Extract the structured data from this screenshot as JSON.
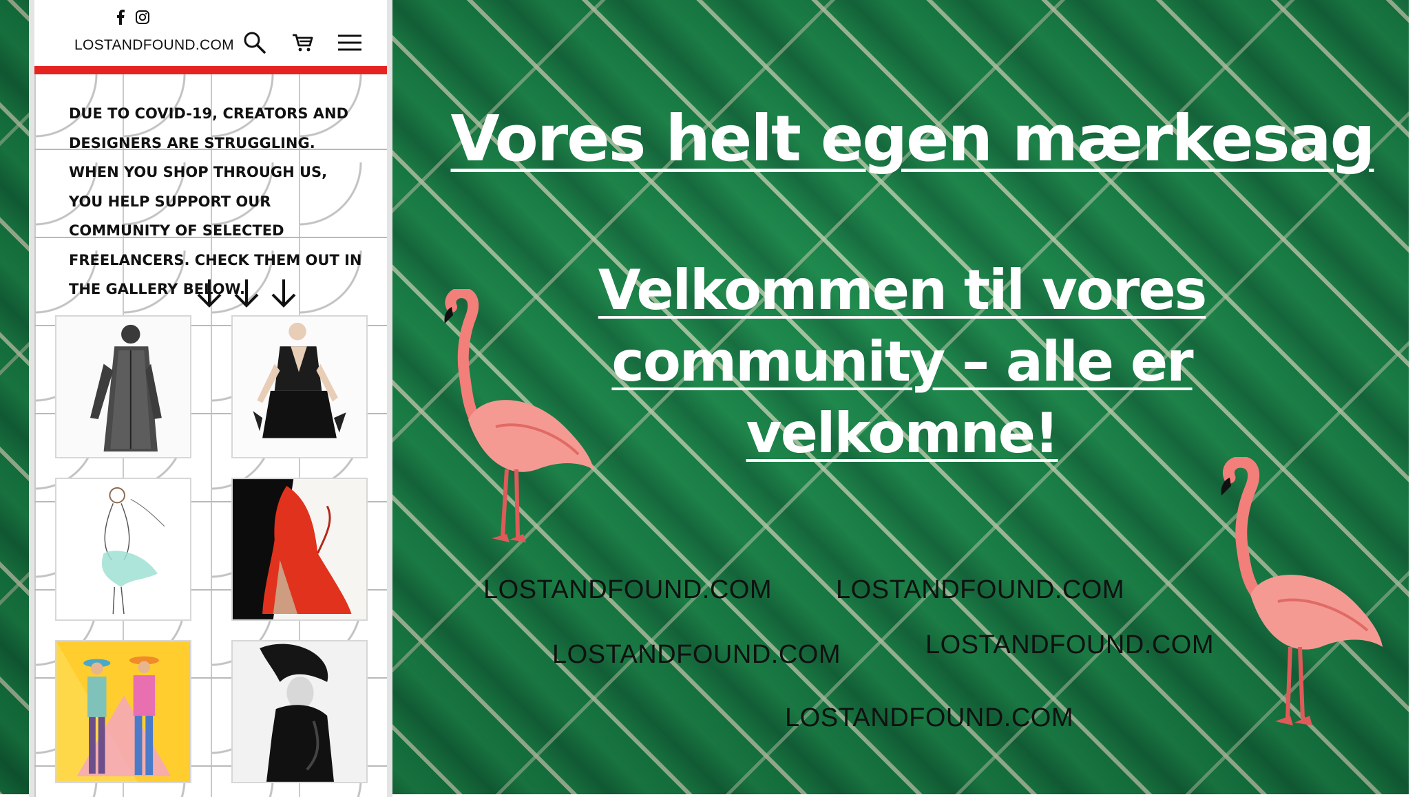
{
  "header": {
    "brand": "LOSTANDFOUND.COM",
    "social_icons": [
      "facebook-icon",
      "instagram-icon"
    ],
    "actions": [
      "search-icon",
      "cart-icon",
      "hamburger-menu-icon"
    ],
    "accent_color": "#e52421"
  },
  "intro": {
    "text": "DUE TO COVID-19, CREATORS AND DESIGNERS ARE STRUGGLING. WHEN YOU SHOP THROUGH US, YOU HELP SUPPORT OUR COMMUNITY OF SELECTED FREELANCERS. CHECK THEM OUT IN THE GALLERY BELOW."
  },
  "gallery": {
    "arrows": [
      "arrow-down-icon",
      "arrow-down-icon",
      "arrow-down-icon"
    ],
    "items": [
      "fashion-sketch-coat",
      "fashion-sketch-black-dress",
      "fashion-sketch-mint-dress",
      "fashion-sketch-red-coat",
      "fashion-sketch-colorful-duo",
      "fashion-photo-black-white"
    ]
  },
  "hero": {
    "title": "Vores helt egen mærkesag",
    "subtitle": "Velkommen til vores community – alle er velkomne!",
    "watermarks": [
      "LOSTANDFOUND.COM",
      "LOSTANDFOUND.COM",
      "LOSTANDFOUND.COM",
      "LOSTANDFOUND.COM",
      "LOSTANDFOUND.COM"
    ],
    "decorations": [
      "flamingo-illustration",
      "flamingo-illustration"
    ],
    "background": "green-tile-photo"
  }
}
